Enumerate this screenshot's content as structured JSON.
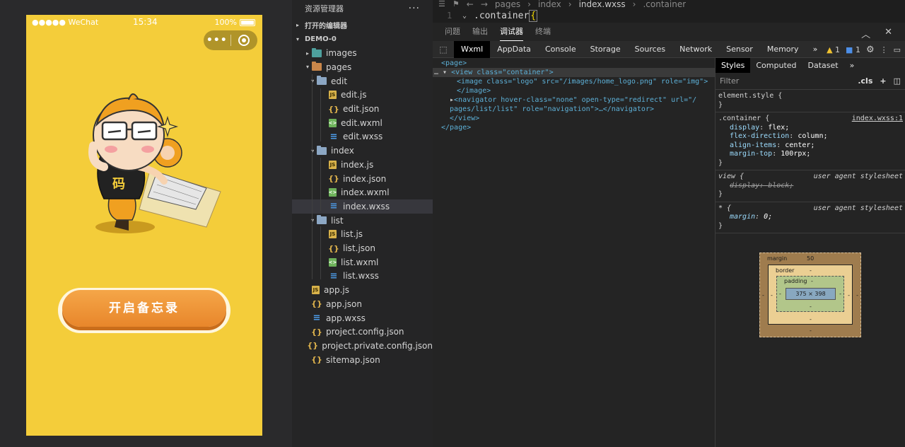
{
  "simulator": {
    "carrier": "●●●●● WeChat",
    "time": "15:34",
    "battery": "100%",
    "capsule_more": "•••",
    "start_button": "开启备忘录"
  },
  "explorer": {
    "title": "资源管理器",
    "more": "···",
    "open_editors": "打开的编辑器",
    "project": "DEMO-0",
    "items": [
      {
        "label": "images",
        "depth": 1,
        "kind": "folder-img",
        "twisty": "▸"
      },
      {
        "label": "pages",
        "depth": 1,
        "kind": "folder-pages",
        "twisty": "▾"
      },
      {
        "label": "edit",
        "depth": 2,
        "kind": "folder",
        "twisty": "▾"
      },
      {
        "label": "edit.js",
        "depth": 3,
        "kind": "js"
      },
      {
        "label": "edit.json",
        "depth": 3,
        "kind": "json"
      },
      {
        "label": "edit.wxml",
        "depth": 3,
        "kind": "wxml"
      },
      {
        "label": "edit.wxss",
        "depth": 3,
        "kind": "wxss"
      },
      {
        "label": "index",
        "depth": 2,
        "kind": "folder",
        "twisty": "▾"
      },
      {
        "label": "index.js",
        "depth": 3,
        "kind": "js"
      },
      {
        "label": "index.json",
        "depth": 3,
        "kind": "json"
      },
      {
        "label": "index.wxml",
        "depth": 3,
        "kind": "wxml"
      },
      {
        "label": "index.wxss",
        "depth": 3,
        "kind": "wxss",
        "selected": true
      },
      {
        "label": "list",
        "depth": 2,
        "kind": "folder",
        "twisty": "▾"
      },
      {
        "label": "list.js",
        "depth": 3,
        "kind": "js"
      },
      {
        "label": "list.json",
        "depth": 3,
        "kind": "json"
      },
      {
        "label": "list.wxml",
        "depth": 3,
        "kind": "wxml"
      },
      {
        "label": "list.wxss",
        "depth": 3,
        "kind": "wxss"
      },
      {
        "label": "app.js",
        "depth": 1,
        "kind": "js"
      },
      {
        "label": "app.json",
        "depth": 1,
        "kind": "json"
      },
      {
        "label": "app.wxss",
        "depth": 1,
        "kind": "wxss"
      },
      {
        "label": "project.config.json",
        "depth": 1,
        "kind": "json"
      },
      {
        "label": "project.private.config.json",
        "depth": 1,
        "kind": "json"
      },
      {
        "label": "sitemap.json",
        "depth": 1,
        "kind": "json"
      }
    ]
  },
  "editor": {
    "breadcrumbs": [
      "pages",
      "›",
      "index",
      "›",
      "index.wxss",
      "›",
      ".container"
    ],
    "line_number": "1",
    "code_selector": ".container",
    "code_brace": "{"
  },
  "devtools": {
    "panel_tabs": [
      "问题",
      "输出",
      "调试器",
      "终端"
    ],
    "active_panel": 2,
    "tabs": [
      "Wxml",
      "AppData",
      "Console",
      "Storage",
      "Sources",
      "Network",
      "Sensor",
      "Memory"
    ],
    "active_tab": 0,
    "overflow": "»",
    "warnings": "1",
    "infos": "1",
    "wxml_lines": [
      "<page>",
      "<view class=\"container\">",
      "<image class=\"logo\" src=\"/images/home_logo.png\" role=\"img\">",
      "</image>",
      "<navigator hover-class=\"none\" open-type=\"redirect\" url=\"/",
      "pages/list/list\" role=\"navigation\">…</navigator>",
      "</view>",
      "</page>"
    ],
    "styles": {
      "tabs": [
        "Styles",
        "Computed",
        "Dataset"
      ],
      "filter_placeholder": "Filter",
      "cls": ".cls",
      "rules": [
        {
          "selector": "element.style {",
          "props": [],
          "close": "}"
        },
        {
          "selector": ".container {",
          "source": "index.wxss:1",
          "props": [
            [
              "display",
              "flex;"
            ],
            [
              "flex-direction",
              "column;"
            ],
            [
              "align-items",
              "center;"
            ],
            [
              "margin-top",
              "100rpx;"
            ]
          ],
          "close": "}"
        },
        {
          "selector": "view {",
          "source": "user agent stylesheet",
          "props": [
            [
              "display",
              "block;"
            ]
          ],
          "close": "}",
          "struck": true
        },
        {
          "selector": "* {",
          "source": "user agent stylesheet",
          "props": [
            [
              "margin",
              "0;"
            ]
          ],
          "close": "}",
          "italic": true
        }
      ],
      "box_model": {
        "margin_label": "margin",
        "margin_top": "50",
        "border_label": "border",
        "padding_label": "padding",
        "dash": "-",
        "content": "375 × 398"
      }
    }
  }
}
